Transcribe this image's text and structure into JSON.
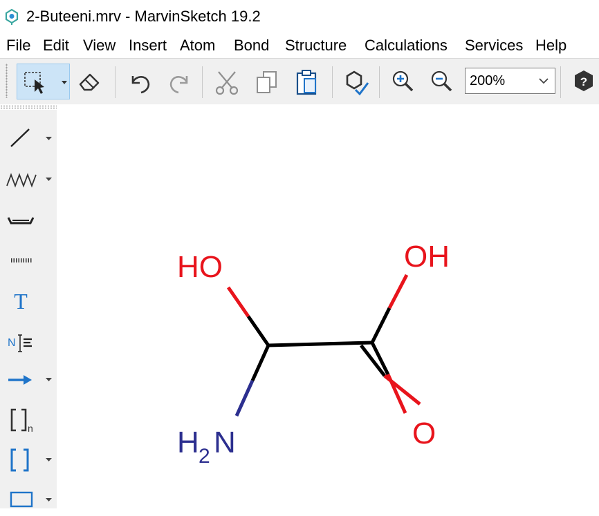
{
  "window": {
    "title": "2-Buteeni.mrv - MarvinSketch 19.2"
  },
  "menu": [
    "File",
    "Edit",
    "View",
    "Insert",
    "Atom",
    "Bond",
    "Structure",
    "Calculations",
    "Services",
    "Help"
  ],
  "toolbar": {
    "buttons": [
      "selection-tool",
      "eraser",
      "undo",
      "redo",
      "cut",
      "copy",
      "paste",
      "clean-structure",
      "zoom-in",
      "zoom-out",
      "help"
    ],
    "zoom_value": "200%"
  },
  "left_toolbar": {
    "tools": [
      "single-bond",
      "chain",
      "ring",
      "dashed-bond",
      "text",
      "name-to-structure",
      "reaction-arrow",
      "sgroup-bracket",
      "bracket",
      "rectangle"
    ],
    "text_tool_glyph": "T",
    "name_tool_glyph": "N",
    "sgroup_subscript": "n"
  },
  "molecule": {
    "labels": {
      "hydroxyl_left": "HO",
      "hydroxyl_right": "OH",
      "carbonyl_oxygen": "O",
      "amine_h": "H",
      "amine_sub": "2",
      "amine_n": "N"
    },
    "colors": {
      "oxygen": "#e8141c",
      "nitrogen": "#2c2f8f",
      "carbon": "#000000"
    }
  },
  "colors": {
    "accent": "#1f74c9",
    "selection_bg": "#cce4f7"
  }
}
